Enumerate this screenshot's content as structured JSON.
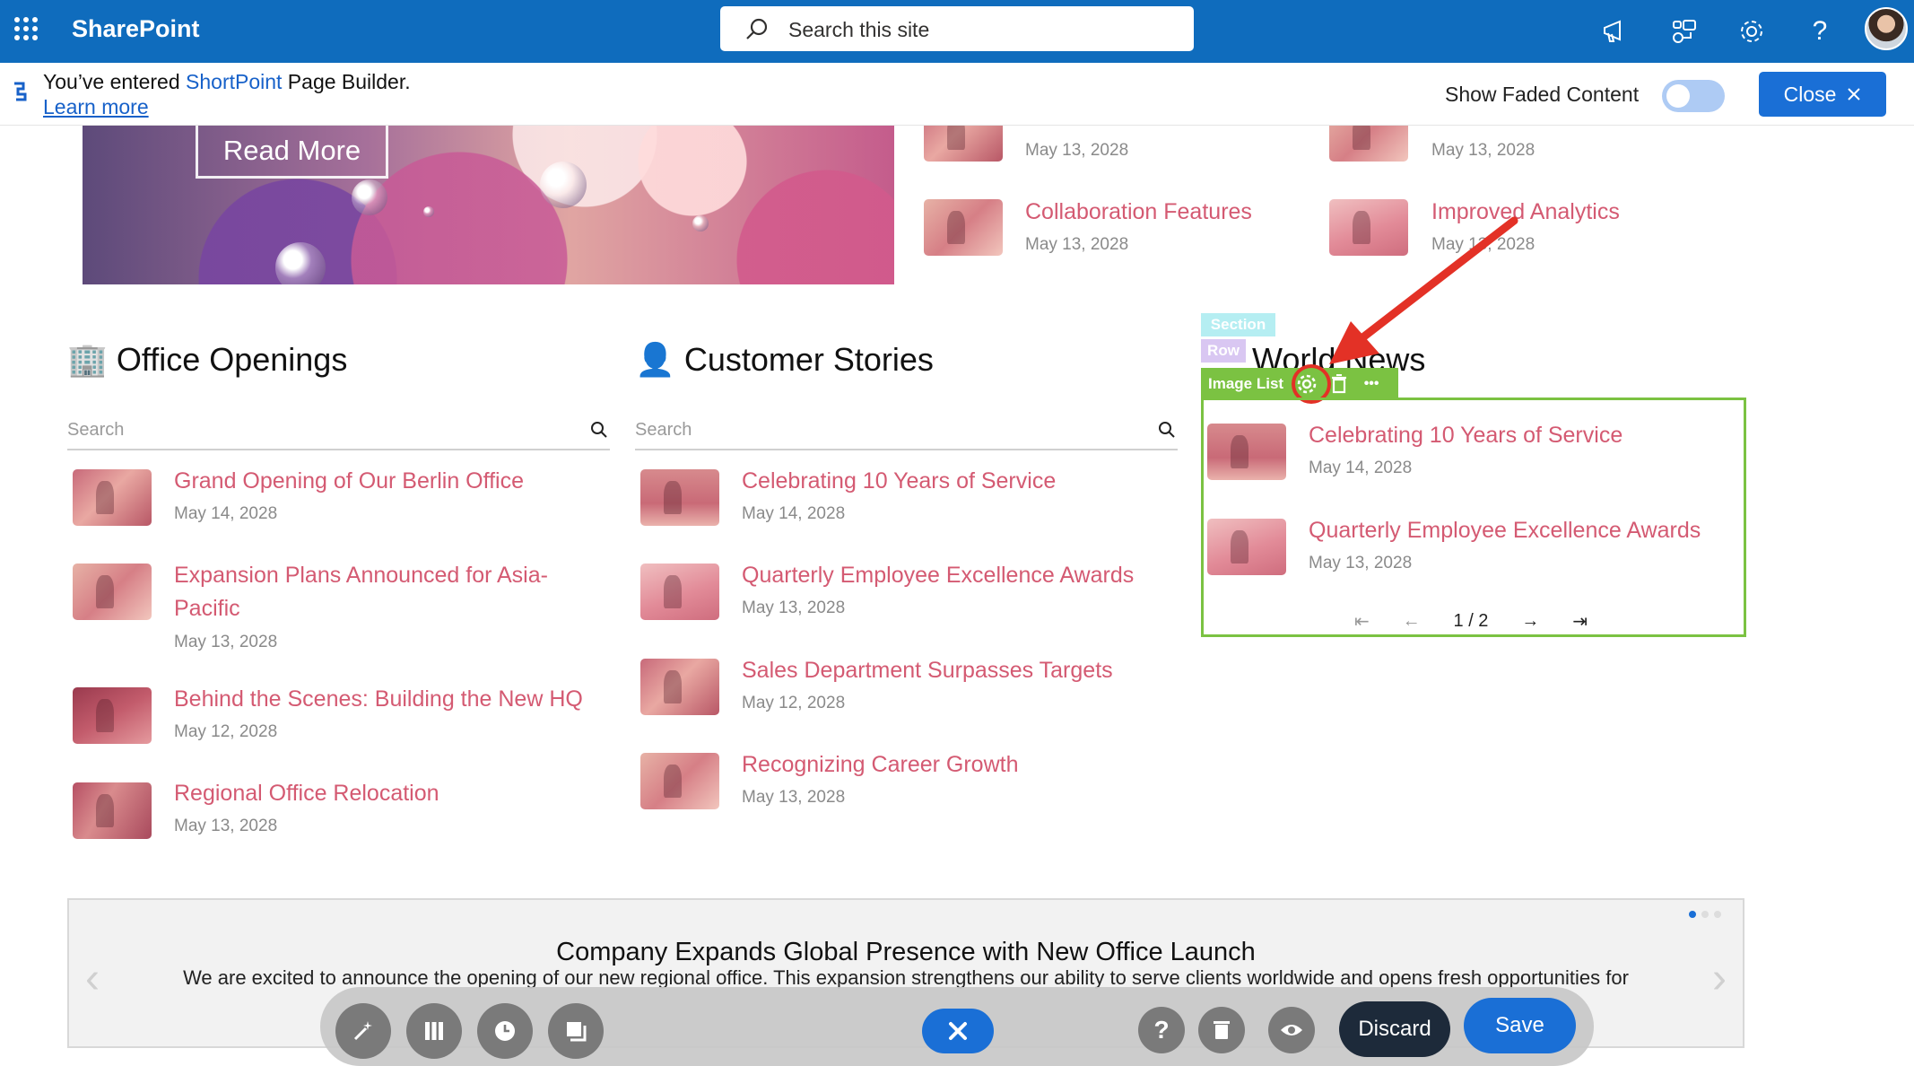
{
  "suite": {
    "brand": "SharePoint",
    "search_placeholder": "Search this site",
    "icons": [
      "megaphone-icon",
      "share-icon",
      "gear-icon",
      "help-icon"
    ],
    "help_glyph": "?",
    "accent": "#0f6cbd"
  },
  "banner": {
    "msg_prefix": "You’ve entered ",
    "msg_brand": "ShortPoint",
    "msg_suffix": " Page Builder.",
    "learn_more": "Learn more",
    "show_faded": "Show Faded Content",
    "close_label": "Close"
  },
  "hero": {
    "read_more": "Read More"
  },
  "top_news": [
    {
      "title": "",
      "date": "May 13, 2028"
    },
    {
      "title": "",
      "date": "May 13, 2028"
    },
    {
      "title": "Collaboration Features",
      "date": "May 13, 2028"
    },
    {
      "title": "Improved Analytics",
      "date": "May 13, 2028"
    }
  ],
  "office_openings": {
    "icon": "🏢",
    "heading": "Office Openings",
    "search_placeholder": "Search",
    "items": [
      {
        "title": "Grand Opening of Our Berlin Office",
        "date": "May 14, 2028"
      },
      {
        "title": "Expansion Plans Announced for Asia-",
        "title_line2": "Pacific",
        "date": "May 13, 2028"
      },
      {
        "title": "Behind the Scenes: Building the New HQ",
        "date": "May 12, 2028"
      },
      {
        "title": "Regional Office Relocation",
        "date": "May 13, 2028"
      }
    ]
  },
  "customer_stories": {
    "icon": "👤",
    "heading": "Customer Stories",
    "search_placeholder": "Search",
    "items": [
      {
        "title": "Celebrating 10 Years of Service",
        "date": "May 14, 2028"
      },
      {
        "title": "Quarterly Employee Excellence Awards",
        "date": "May 13, 2028"
      },
      {
        "title": "Sales Department Surpasses Targets",
        "date": "May 12, 2028"
      },
      {
        "title": "Recognizing Career Growth",
        "date": "May 13, 2028"
      }
    ]
  },
  "world_news": {
    "heading": "World News",
    "builder": {
      "section_tag": "Section",
      "row_tag": "Row",
      "element_tag": "Image List",
      "more_glyph": "•••"
    },
    "items": [
      {
        "title": "Celebrating 10 Years of Service",
        "date": "May 14, 2028"
      },
      {
        "title": "Quarterly Employee Excellence Awards",
        "date": "May 13, 2028"
      }
    ],
    "pager": {
      "first": "⇤",
      "prev": "←",
      "current": "1 / 2",
      "next": "→",
      "last": "⇥"
    }
  },
  "carousel": {
    "title": "Company Expands Global Presence with New Office Launch",
    "text": "We are excited to announce the opening of our new regional office. This expansion strengthens our ability to serve clients worldwide and opens fresh opportunities for"
  },
  "toolbar": {
    "discard": "Discard",
    "save": "Save",
    "help_glyph": "?"
  },
  "colors": {
    "link": "#d45a72",
    "builder_green": "#7bc242",
    "annotation_red": "#e33126",
    "primary": "#1a6fd6"
  }
}
